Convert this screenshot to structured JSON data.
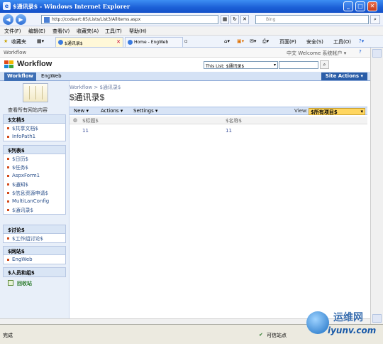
{
  "window": {
    "title": "$通讯录$ - Windows Internet Explorer",
    "address": "http://codeart:85/Lists/List3/AllItems.aspx",
    "search_placeholder": "Bing"
  },
  "menu": [
    "文件(F)",
    "编辑(E)",
    "查看(V)",
    "收藏夹(A)",
    "工具(T)",
    "帮助(H)"
  ],
  "toolbar": {
    "favorites_label": "收藏夹",
    "tabs": [
      "$通讯录$",
      "Home - EngWeb"
    ],
    "page_label": "页面(P)",
    "safety_label": "安全(S)",
    "tools_label": "工具(O)"
  },
  "sharepoint": {
    "top_left": "Workflow",
    "top_right": "中文   Welcome 系统帐户 ▾",
    "site_title": "Workflow",
    "search_scope": "This List: $通讯录$",
    "nav_tabs": [
      "Workflow",
      "EngWeb"
    ],
    "site_actions": "Site Actions ▾",
    "breadcrumb": "Workflow > $通讯录$",
    "page_title": "$通讯录$",
    "view_all": "查看所有网站内容",
    "sections": [
      {
        "header": "$文档$",
        "items": [
          "$共享文档$",
          "InfoPath1"
        ]
      },
      {
        "header": "$列表$",
        "items": [
          "$日历$",
          "$任务$",
          "AspxForm1",
          "$通知$",
          "$信息资源申请$",
          "MultiLanConfig",
          "$通讯录$"
        ]
      },
      {
        "header": "$讨论$",
        "items": [
          "$工作组讨论$"
        ]
      },
      {
        "header": "$网站$",
        "items": [
          "EngWeb"
        ]
      },
      {
        "header": "$人员和组$",
        "items": []
      }
    ],
    "recycle_bin": "回收站",
    "list_toolbar": {
      "new": "New ▾",
      "actions": "Actions ▾",
      "settings": "Settings ▾",
      "view_label": "View:",
      "view_value": "$所有项目$"
    },
    "columns": [
      "$标题$",
      "$名称$"
    ],
    "rows": [
      [
        "11",
        "11"
      ]
    ]
  },
  "status": {
    "left": "完成",
    "zone": "可信站点"
  },
  "watermark": {
    "line1": "运维网",
    "line2": "iyunv.com"
  },
  "colors": {
    "titlebar": "#1b5fd6",
    "sp_nav": "#d5e2f5",
    "site_actions": "#2a5da8",
    "view_select": "#ffd660"
  }
}
